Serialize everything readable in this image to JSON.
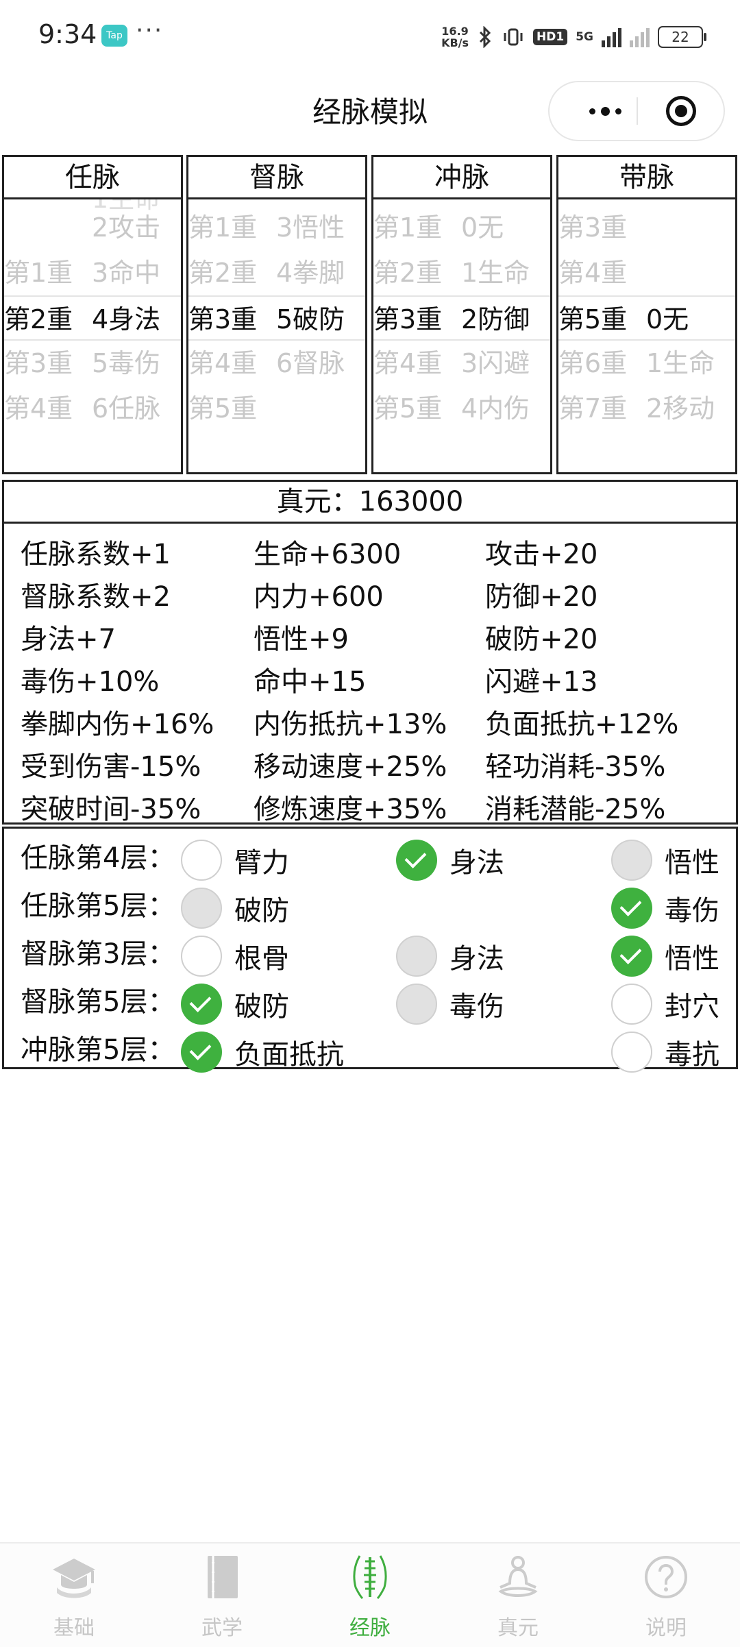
{
  "status_bar": {
    "time": "9:34",
    "tap_badge": "Tap",
    "net_speed_value": "16.9",
    "net_speed_unit": "KB/s",
    "hd_label": "HD1",
    "network": "5G",
    "battery": "22"
  },
  "header": {
    "title": "经脉模拟"
  },
  "pickers": [
    {
      "name": "任脉",
      "rows": [
        {
          "level": "",
          "option": "2攻击",
          "state": "dim"
        },
        {
          "level": "第1重",
          "option": "3命中",
          "state": "dim"
        },
        {
          "level": "第2重",
          "option": "4身法",
          "state": "sel"
        },
        {
          "level": "第3重",
          "option": "5毒伤",
          "state": "dim"
        },
        {
          "level": "第4重",
          "option": "6任脉",
          "state": "dim"
        }
      ]
    },
    {
      "name": "督脉",
      "rows": [
        {
          "level": "第1重",
          "option": "3悟性",
          "state": "dim"
        },
        {
          "level": "第2重",
          "option": "4拳脚",
          "state": "dim"
        },
        {
          "level": "第3重",
          "option": "5破防",
          "state": "sel"
        },
        {
          "level": "第4重",
          "option": "6督脉",
          "state": "dim"
        },
        {
          "level": "第5重",
          "option": "",
          "state": "dim"
        }
      ]
    },
    {
      "name": "冲脉",
      "rows": [
        {
          "level": "第1重",
          "option": "0无",
          "state": "dim"
        },
        {
          "level": "第2重",
          "option": "1生命",
          "state": "dim"
        },
        {
          "level": "第3重",
          "option": "2防御",
          "state": "sel"
        },
        {
          "level": "第4重",
          "option": "3闪避",
          "state": "dim"
        },
        {
          "level": "第5重",
          "option": "4内伤",
          "state": "dim"
        }
      ]
    },
    {
      "name": "带脉",
      "rows": [
        {
          "level": "第3重",
          "option": "",
          "state": "dim"
        },
        {
          "level": "第4重",
          "option": "",
          "state": "dim"
        },
        {
          "level": "第5重",
          "option": "0无",
          "state": "sel"
        },
        {
          "level": "第6重",
          "option": "1生命",
          "state": "dim"
        },
        {
          "level": "第7重",
          "option": "2移动",
          "state": "dim"
        }
      ]
    }
  ],
  "zhenyuan": {
    "label": "真元：163000"
  },
  "stats": [
    [
      "任脉系数+1",
      "生命+6300",
      "攻击+20"
    ],
    [
      "督脉系数+2",
      "内力+600",
      "防御+20"
    ],
    [
      "身法+7",
      "悟性+9",
      "破防+20"
    ],
    [
      "毒伤+10%",
      "命中+15",
      "闪避+13"
    ],
    [
      "拳脚内伤+16%",
      "内伤抵抗+13%",
      "负面抵抗+12%"
    ],
    [
      "受到伤害-15%",
      "移动速度+25%",
      "轻功消耗-35%"
    ],
    [
      "突破时间-35%",
      "修炼速度+35%",
      "消耗潜能-25%"
    ]
  ],
  "options": [
    {
      "label": "任脉第4层：",
      "choices": [
        {
          "text": "臂力",
          "state": "unchecked",
          "col": 0
        },
        {
          "text": "身法",
          "state": "checked",
          "col": 1
        },
        {
          "text": "悟性",
          "state": "disabled",
          "col": 2
        }
      ]
    },
    {
      "label": "任脉第5层：",
      "choices": [
        {
          "text": "破防",
          "state": "disabled",
          "col": 0
        },
        {
          "text": "毒伤",
          "state": "checked",
          "col": 2
        }
      ]
    },
    {
      "label": "督脉第3层：",
      "choices": [
        {
          "text": "根骨",
          "state": "unchecked",
          "col": 0
        },
        {
          "text": "身法",
          "state": "disabled",
          "col": 1
        },
        {
          "text": "悟性",
          "state": "checked",
          "col": 2
        }
      ]
    },
    {
      "label": "督脉第5层：",
      "choices": [
        {
          "text": "破防",
          "state": "checked",
          "col": 0
        },
        {
          "text": "毒伤",
          "state": "disabled",
          "col": 1
        },
        {
          "text": "封穴",
          "state": "unchecked",
          "col": 2
        }
      ]
    },
    {
      "label": "冲脉第5层：",
      "choices": [
        {
          "text": "负面抵抗",
          "state": "checked",
          "col": 0
        },
        {
          "text": "毒抗",
          "state": "unchecked",
          "col": 2
        }
      ]
    }
  ],
  "tabbar": {
    "active_color": "#3fae3f",
    "inactive_color": "#c6c6c6",
    "tabs": [
      {
        "label": "基础",
        "icon": "graduation-cap-icon",
        "active": false
      },
      {
        "label": "武学",
        "icon": "book-icon",
        "active": false
      },
      {
        "label": "经脉",
        "icon": "meridian-body-icon",
        "active": true
      },
      {
        "label": "真元",
        "icon": "meditation-icon",
        "active": false
      },
      {
        "label": "说明",
        "icon": "help-circle-icon",
        "active": false
      }
    ]
  }
}
